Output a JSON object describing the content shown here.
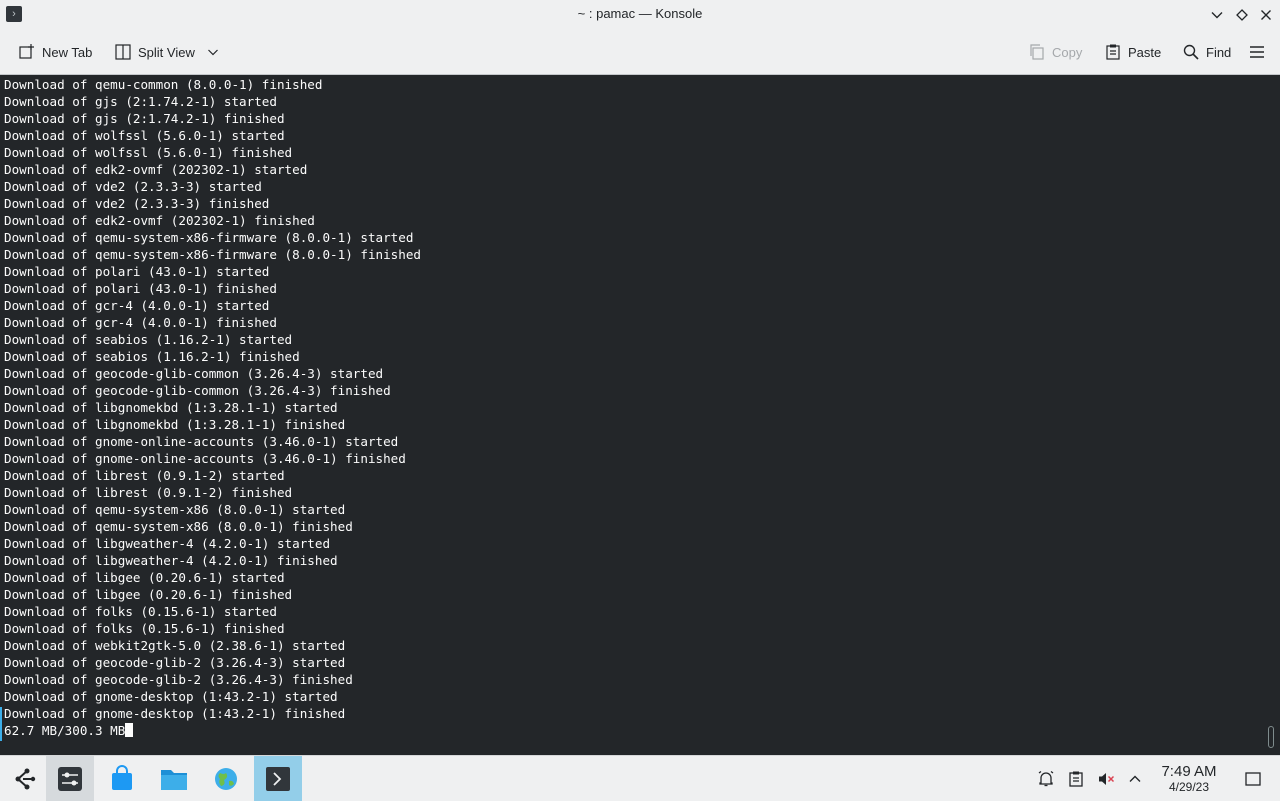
{
  "window": {
    "title": "~ : pamac — Konsole",
    "app_icon_glyph": "›"
  },
  "toolbar": {
    "new_tab_label": "New Tab",
    "split_view_label": "Split View",
    "copy_label": "Copy",
    "paste_label": "Paste",
    "find_label": "Find"
  },
  "terminal": {
    "lines": [
      "Download of qemu-common (8.0.0-1) finished",
      "Download of gjs (2:1.74.2-1) started",
      "Download of gjs (2:1.74.2-1) finished",
      "Download of wolfssl (5.6.0-1) started",
      "Download of wolfssl (5.6.0-1) finished",
      "Download of edk2-ovmf (202302-1) started",
      "Download of vde2 (2.3.3-3) started",
      "Download of vde2 (2.3.3-3) finished",
      "Download of edk2-ovmf (202302-1) finished",
      "Download of qemu-system-x86-firmware (8.0.0-1) started",
      "Download of qemu-system-x86-firmware (8.0.0-1) finished",
      "Download of polari (43.0-1) started",
      "Download of polari (43.0-1) finished",
      "Download of gcr-4 (4.0.0-1) started",
      "Download of gcr-4 (4.0.0-1) finished",
      "Download of seabios (1.16.2-1) started",
      "Download of seabios (1.16.2-1) finished",
      "Download of geocode-glib-common (3.26.4-3) started",
      "Download of geocode-glib-common (3.26.4-3) finished",
      "Download of libgnomekbd (1:3.28.1-1) started",
      "Download of libgnomekbd (1:3.28.1-1) finished",
      "Download of gnome-online-accounts (3.46.0-1) started",
      "Download of gnome-online-accounts (3.46.0-1) finished",
      "Download of librest (0.9.1-2) started",
      "Download of librest (0.9.1-2) finished",
      "Download of qemu-system-x86 (8.0.0-1) started",
      "Download of qemu-system-x86 (8.0.0-1) finished",
      "Download of libgweather-4 (4.2.0-1) started",
      "Download of libgweather-4 (4.2.0-1) finished",
      "Download of libgee (0.20.6-1) started",
      "Download of libgee (0.20.6-1) finished",
      "Download of folks (0.15.6-1) started",
      "Download of folks (0.15.6-1) finished",
      "Download of webkit2gtk-5.0 (2.38.6-1) started",
      "Download of geocode-glib-2 (3.26.4-3) started",
      "Download of geocode-glib-2 (3.26.4-3) finished",
      "Download of gnome-desktop (1:43.2-1) started",
      "Download of gnome-desktop (1:43.2-1) finished"
    ],
    "progress_line": "62.7 MB/300.3 MB"
  },
  "taskbar": {
    "clock_time": "7:49 AM",
    "clock_date": "4/29/23"
  },
  "colors": {
    "terminal_bg": "#232629",
    "terminal_fg": "#fcfcfc",
    "chrome_bg": "#eff0f1",
    "accent": "#3daee9"
  }
}
